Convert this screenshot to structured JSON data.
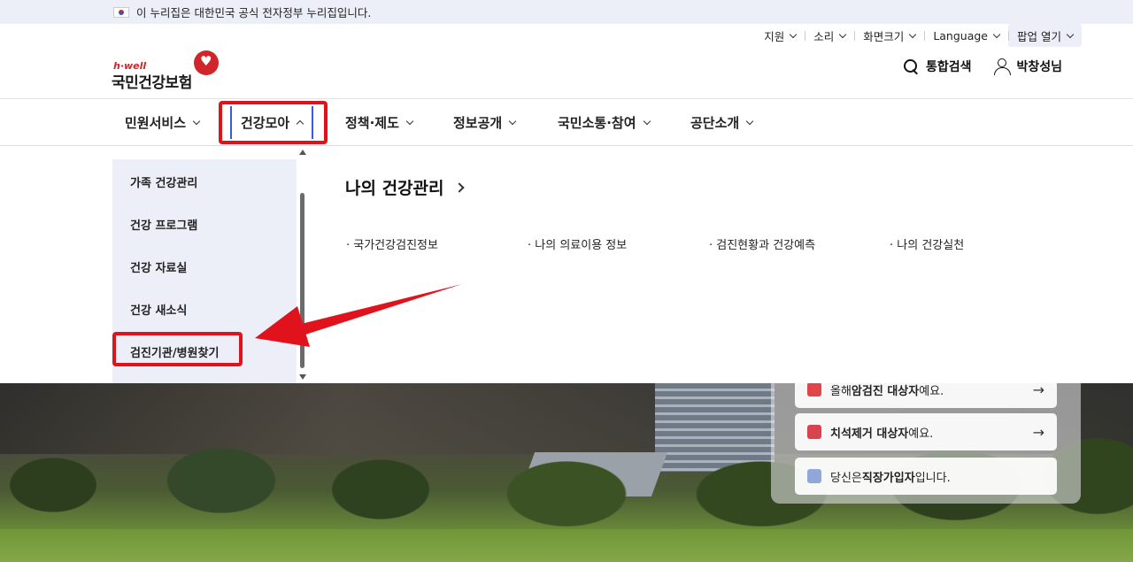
{
  "gov_banner": {
    "text": "이 누리집은 대한민국 공식 전자정부 누리집입니다."
  },
  "util_menu": [
    {
      "label": "지원"
    },
    {
      "label": "소리"
    },
    {
      "label": "화면크기"
    },
    {
      "label": "Language"
    },
    {
      "label": "팝업 열기"
    }
  ],
  "logo": {
    "tagline": "h·well",
    "name": "국민건강보험"
  },
  "header_actions": {
    "search_label": "통합검색",
    "user_label": "박창성님"
  },
  "gnb": [
    {
      "label": "민원서비스"
    },
    {
      "label": "건강모아"
    },
    {
      "label": "정책·제도"
    },
    {
      "label": "정보공개"
    },
    {
      "label": "국민소통·참여"
    },
    {
      "label": "공단소개"
    }
  ],
  "side_menu": [
    {
      "label": "가족 건강관리"
    },
    {
      "label": "건강 프로그램"
    },
    {
      "label": "건강 자료실"
    },
    {
      "label": "건강 새소식"
    },
    {
      "label": "검진기관/병원찾기"
    }
  ],
  "submenu": {
    "title": "나의 건강관리",
    "links": [
      {
        "label": "· 국가건강검진정보"
      },
      {
        "label": "· 나의 의료이용 정보"
      },
      {
        "label": "· 검진현황과 건강예측"
      },
      {
        "label": "· 나의 건강실천"
      }
    ]
  },
  "hero_cards": [
    {
      "pre": "올해 ",
      "bold": "암검진 대상자",
      "post": "예요.",
      "arrow": "→"
    },
    {
      "pre": "",
      "bold": "치석제거 대상자",
      "post": "예요.",
      "arrow": "→"
    },
    {
      "pre": "당신은 ",
      "bold": "직장가입자",
      "post": "입니다.",
      "arrow": ""
    }
  ],
  "colors": {
    "accent_red": "#e0121b",
    "active_blue": "#3b5bdb",
    "banner_bg": "#eceef8"
  }
}
